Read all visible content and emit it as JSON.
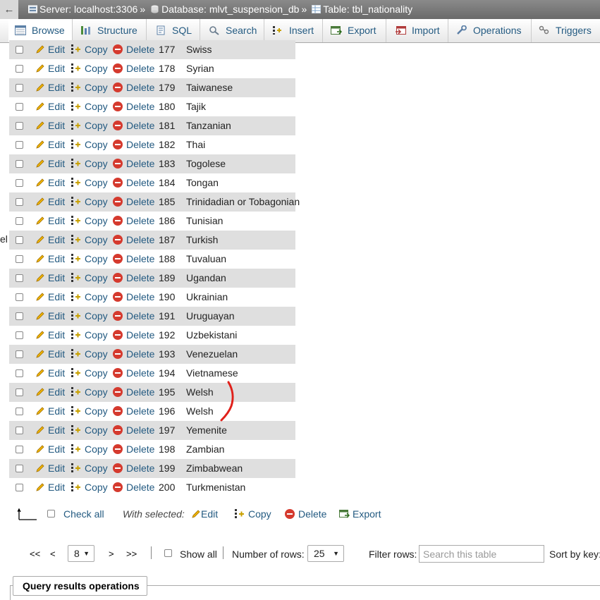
{
  "breadcrumb": {
    "back": "←",
    "server": "Server: localhost:3306",
    "database": "Database: mlvt_suspension_db",
    "table": "Table: tbl_nationality",
    "separator": "»"
  },
  "tabs": [
    {
      "label": "Browse",
      "icon": "browse-icon",
      "active": true
    },
    {
      "label": "Structure",
      "icon": "structure-icon"
    },
    {
      "label": "SQL",
      "icon": "sql-icon"
    },
    {
      "label": "Search",
      "icon": "search-icon"
    },
    {
      "label": "Insert",
      "icon": "insert-icon"
    },
    {
      "label": "Export",
      "icon": "export-icon"
    },
    {
      "label": "Import",
      "icon": "import-icon"
    },
    {
      "label": "Operations",
      "icon": "wrench-icon"
    },
    {
      "label": "Triggers",
      "icon": "triggers-icon"
    }
  ],
  "row_actions": {
    "edit": "Edit",
    "copy": "Copy",
    "delete": "Delete"
  },
  "rows": [
    {
      "id": "177",
      "name": "Swiss"
    },
    {
      "id": "178",
      "name": "Syrian"
    },
    {
      "id": "179",
      "name": "Taiwanese"
    },
    {
      "id": "180",
      "name": "Tajik"
    },
    {
      "id": "181",
      "name": "Tanzanian"
    },
    {
      "id": "182",
      "name": "Thai"
    },
    {
      "id": "183",
      "name": "Togolese"
    },
    {
      "id": "184",
      "name": "Tongan"
    },
    {
      "id": "185",
      "name": "Trinidadian or Tobagonian"
    },
    {
      "id": "186",
      "name": "Tunisian"
    },
    {
      "id": "187",
      "name": "Turkish"
    },
    {
      "id": "188",
      "name": "Tuvaluan"
    },
    {
      "id": "189",
      "name": "Ugandan"
    },
    {
      "id": "190",
      "name": "Ukrainian"
    },
    {
      "id": "191",
      "name": "Uruguayan"
    },
    {
      "id": "192",
      "name": "Uzbekistani"
    },
    {
      "id": "193",
      "name": "Venezuelan"
    },
    {
      "id": "194",
      "name": "Vietnamese"
    },
    {
      "id": "195",
      "name": "Welsh"
    },
    {
      "id": "196",
      "name": "Welsh"
    },
    {
      "id": "197",
      "name": "Yemenite"
    },
    {
      "id": "198",
      "name": "Zambian"
    },
    {
      "id": "199",
      "name": "Zimbabwean"
    },
    {
      "id": "200",
      "name": "Turkmenistan"
    }
  ],
  "bulk": {
    "check_all": "Check all",
    "with_selected": "With selected:",
    "edit": "Edit",
    "copy": "Copy",
    "delete": "Delete",
    "export": "Export"
  },
  "pager": {
    "first": "<<",
    "prev": "<",
    "page": "8",
    "next": ">",
    "last": ">>",
    "show_all": "Show all",
    "rows_label": "Number of rows:",
    "rows_value": "25",
    "filter_label": "Filter rows:",
    "filter_placeholder": "Search this table",
    "sort_label": "Sort by key:"
  },
  "query_ops": "Query results operations",
  "side_fragment": "el",
  "colors": {
    "link": "#235a81",
    "row_stripe": "#dfdfdf",
    "delete_red": "#d53a2e",
    "annotation_red": "#e0201a"
  }
}
